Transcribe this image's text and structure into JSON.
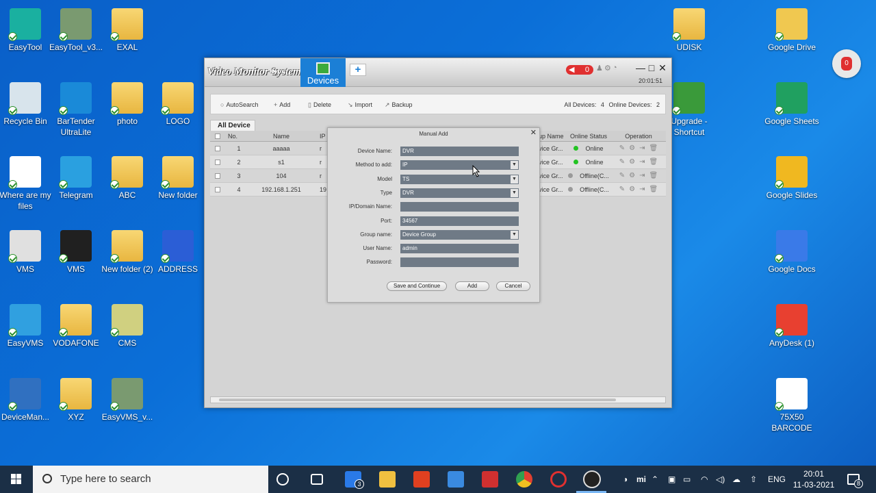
{
  "desktop": {
    "left_icons": [
      {
        "label": "EasyTool",
        "icon": "wrench-icon",
        "color": "#1ab0a0"
      },
      {
        "label": "EasyTool_v3...",
        "icon": "globe-shield-icon",
        "color": "#7a9a70"
      },
      {
        "label": "EXAL",
        "icon": "folder-excel-icon",
        "color": "#f0c850"
      },
      {
        "label": "Recycle Bin",
        "icon": "recycle-bin-icon",
        "color": "#d8e4ec"
      },
      {
        "label": "BarTender UltraLite",
        "icon": "bartender-icon",
        "color": "#1a8ad8"
      },
      {
        "label": "photo",
        "icon": "folder-icon",
        "color": "#f0c850"
      },
      {
        "label": "LOGO",
        "icon": "folder-logo-icon",
        "color": "#c83030"
      },
      {
        "label": "Where are my files",
        "icon": "blank-file-icon",
        "color": "#ffffff"
      },
      {
        "label": "Telegram",
        "icon": "telegram-icon",
        "color": "#2aa0e0"
      },
      {
        "label": "ABC",
        "icon": "folder-icon",
        "color": "#f0c850"
      },
      {
        "label": "New folder",
        "icon": "folder-icon",
        "color": "#f0c850"
      },
      {
        "label": "VMS",
        "icon": "vms-camera-icon",
        "color": "#e0e0e0"
      },
      {
        "label": "VMS",
        "icon": "vms-lens-icon",
        "color": "#202020"
      },
      {
        "label": "New folder (2)",
        "icon": "folder-icon",
        "color": "#f0c850"
      },
      {
        "label": "ADDRESS",
        "icon": "word-doc-icon",
        "color": "#2b5ed6"
      },
      {
        "label": "EasyVMS",
        "icon": "easyvms-cloud-icon",
        "color": "#30a0e0"
      },
      {
        "label": "VODAFONE",
        "icon": "folder-excel-icon",
        "color": "#f0c850"
      },
      {
        "label": "CMS",
        "icon": "cms-camera-icon",
        "color": "#d0d080"
      },
      {
        "label": "DeviceMan...",
        "icon": "device-manager-icon",
        "color": "#3070c0"
      },
      {
        "label": "XYZ",
        "icon": "folder-pdf-icon",
        "color": "#f0c850"
      },
      {
        "label": "EasyVMS_v...",
        "icon": "globe-shield-icon",
        "color": "#7a9a70"
      }
    ],
    "right_icons": [
      {
        "label": "UDISK",
        "icon": "folder-excel-icon",
        "color": "#f0c850"
      },
      {
        "label": "Google Drive",
        "icon": "google-drive-icon",
        "color": "#f0c850"
      },
      {
        "label": "Upgrade - Shortcut",
        "icon": "upgrade-icon",
        "color": "#3a9a3a"
      },
      {
        "label": "Google Sheets",
        "icon": "google-sheets-icon",
        "color": "#20a060"
      },
      {
        "label": "Google Slides",
        "icon": "google-slides-icon",
        "color": "#f0b820"
      },
      {
        "label": "Google Docs",
        "icon": "google-docs-icon",
        "color": "#3a7ae8"
      },
      {
        "label": "AnyDesk (1)",
        "icon": "anydesk-icon",
        "color": "#e84030"
      },
      {
        "label": "75X50 BARCODE",
        "icon": "barcode-file-icon",
        "color": "#ffffff"
      }
    ],
    "notification_badge": "0"
  },
  "app": {
    "brand": "Video Monitor System",
    "tab_devices": "Devices",
    "alarm_count": "0",
    "clock": "20:01:51",
    "toolbar": {
      "autosearch": "AutoSearch",
      "add": "Add",
      "delete": "Delete",
      "import": "Import",
      "backup": "Backup",
      "all_devices_label": "All Devices:",
      "all_devices": "4",
      "online_devices_label": "Online Devices:",
      "online_devices": "2"
    },
    "tab_all_device": "All Device",
    "columns": {
      "no": "No.",
      "name": "Name",
      "ip": "IP",
      "group": "up Name",
      "status": "Online Status",
      "operation": "Operation"
    },
    "rows": [
      {
        "no": "1",
        "name": "aaaaa",
        "ip": "r",
        "group": "vice Gr...",
        "status": "Online",
        "status_color": "#22c322"
      },
      {
        "no": "2",
        "name": "s1",
        "ip": "r",
        "group": "vice Gr...",
        "status": "Online",
        "status_color": "#22c322"
      },
      {
        "no": "3",
        "name": "104",
        "ip": "r",
        "group": "vice Gr...",
        "status": "Offline(C...",
        "status_color": "#9a9a9a"
      },
      {
        "no": "4",
        "name": "192.168.1.251",
        "ip": "19",
        "group": "vice Gr...",
        "status": "Offline(C...",
        "status_color": "#9a9a9a"
      }
    ]
  },
  "dialog": {
    "title": "Manual Add",
    "device_name_label": "Device Name:",
    "device_name": "DVR",
    "method_label": "Method to add:",
    "method": "IP",
    "model_label": "Model",
    "model": "TS",
    "type_label": "Type",
    "type": "DVR",
    "ip_label": "IP/Domain Name:",
    "ip": "",
    "port_label": "Port:",
    "port": "34567",
    "group_label": "Group name:",
    "group": "Device Group",
    "user_label": "User Name:",
    "user": "admin",
    "password_label": "Password:",
    "password": "",
    "save_continue": "Save and Continue",
    "add": "Add",
    "cancel": "Cancel"
  },
  "taskbar": {
    "search_placeholder": "Type here to search",
    "todo_badge": "3",
    "lang": "ENG",
    "time": "20:01",
    "date": "11-03-2021",
    "notif_count": "8"
  }
}
